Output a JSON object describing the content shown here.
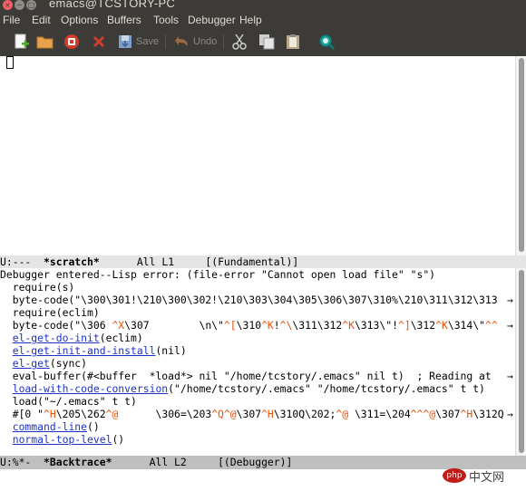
{
  "window": {
    "title": "emacs@TCSTORY-PC",
    "close": "×",
    "min": "−",
    "max": "□"
  },
  "menu": [
    "File",
    "Edit",
    "Options",
    "Buffers",
    "Tools",
    "Debugger",
    "Help"
  ],
  "toolbar": {
    "save_label": "Save",
    "undo_label": "Undo"
  },
  "scratch": {
    "modeline": {
      "status": "U:---",
      "name": "*scratch*",
      "position": "All L1",
      "mode": "[(Fundamental)]"
    }
  },
  "backtrace": {
    "lines": [
      {
        "t": "Debugger entered--Lisp error: (file-error \"Cannot open load file\" \"s\")"
      },
      {
        "t": "  require(s)"
      },
      {
        "t": "  byte-code(\"\\300\\301!\\210\\300\\302!\\210\\303\\304\\305\\306\\307\\310%\\210\\311\\312\\313",
        "arrow": "→"
      },
      {
        "t": "  require(eclim)"
      },
      {
        "parts": [
          {
            "t": "  byte-code(\"\\306 "
          },
          {
            "t": "^X",
            "c": "ctl"
          },
          {
            "t": "\\307        \\n\\\""
          },
          {
            "t": "^[",
            "c": "ctl"
          },
          {
            "t": "\\310"
          },
          {
            "t": "^K",
            "c": "ctl"
          },
          {
            "t": "!"
          },
          {
            "t": "^\\",
            "c": "ctl"
          },
          {
            "t": "\\311\\312"
          },
          {
            "t": "^K",
            "c": "ctl"
          },
          {
            "t": "\\313\\\"!"
          },
          {
            "t": "^]",
            "c": "ctl"
          },
          {
            "t": "\\312"
          },
          {
            "t": "^K",
            "c": "ctl"
          },
          {
            "t": "\\314\\\""
          },
          {
            "t": "^^",
            "c": "ctl"
          }
        ],
        "arrow": "→"
      },
      {
        "parts": [
          {
            "t": "  "
          },
          {
            "t": "el-get-do-init",
            "c": "link"
          },
          {
            "t": "(eclim)"
          }
        ]
      },
      {
        "parts": [
          {
            "t": "  "
          },
          {
            "t": "el-get-init-and-install",
            "c": "link"
          },
          {
            "t": "(nil)"
          }
        ]
      },
      {
        "parts": [
          {
            "t": "  "
          },
          {
            "t": "el-get",
            "c": "link"
          },
          {
            "t": "(sync)"
          }
        ]
      },
      {
        "t": "  eval-buffer(#<buffer  *load*> nil \"/home/tcstory/.emacs\" nil t)  ; Reading at ",
        "arrow": "→"
      },
      {
        "parts": [
          {
            "t": "  "
          },
          {
            "t": "load-with-code-conversion",
            "c": "link"
          },
          {
            "t": "(\"/home/tcstory/.emacs\" \"/home/tcstory/.emacs\" t t)"
          }
        ]
      },
      {
        "t": "  load(\"~/.emacs\" t t)"
      },
      {
        "parts": [
          {
            "t": "  #[0 \""
          },
          {
            "t": "^H",
            "c": "ctl"
          },
          {
            "t": "\\205\\262"
          },
          {
            "t": "^@",
            "c": "ctl"
          },
          {
            "t": "      \\306=\\203"
          },
          {
            "t": "^Q",
            "c": "ctl"
          },
          {
            "t": "^@",
            "c": "ctl"
          },
          {
            "t": "\\307"
          },
          {
            "t": "^H",
            "c": "ctl"
          },
          {
            "t": "\\310Q\\202;"
          },
          {
            "t": "^@",
            "c": "ctl"
          },
          {
            "t": " \\311=\\204"
          },
          {
            "t": "^^",
            "c": "ctl"
          },
          {
            "t": "^@",
            "c": "ctl"
          },
          {
            "t": "\\307"
          },
          {
            "t": "^H",
            "c": "ctl"
          },
          {
            "t": "\\312Q"
          }
        ],
        "arrow": "→"
      },
      {
        "parts": [
          {
            "t": "  "
          },
          {
            "t": "command-line",
            "c": "link"
          },
          {
            "t": "()"
          }
        ]
      },
      {
        "parts": [
          {
            "t": "  "
          },
          {
            "t": "normal-top-level",
            "c": "link"
          },
          {
            "t": "()"
          }
        ]
      }
    ],
    "modeline": {
      "status": "U:%*-",
      "name": "*Backtrace*",
      "position": "All L2",
      "mode": "[(Debugger)]"
    }
  },
  "watermark": {
    "logo": "php",
    "text": "中文网"
  },
  "colors": {
    "link": "#1d33c9",
    "control_char": "#e8510a",
    "chrome": "#3c3b37"
  },
  "icons": [
    "new-file-icon",
    "open-folder-icon",
    "close-buffer-icon",
    "cut-x-icon",
    "save-icon",
    "undo-icon",
    "scissors-icon",
    "copy-icon",
    "paste-icon",
    "search-icon"
  ]
}
